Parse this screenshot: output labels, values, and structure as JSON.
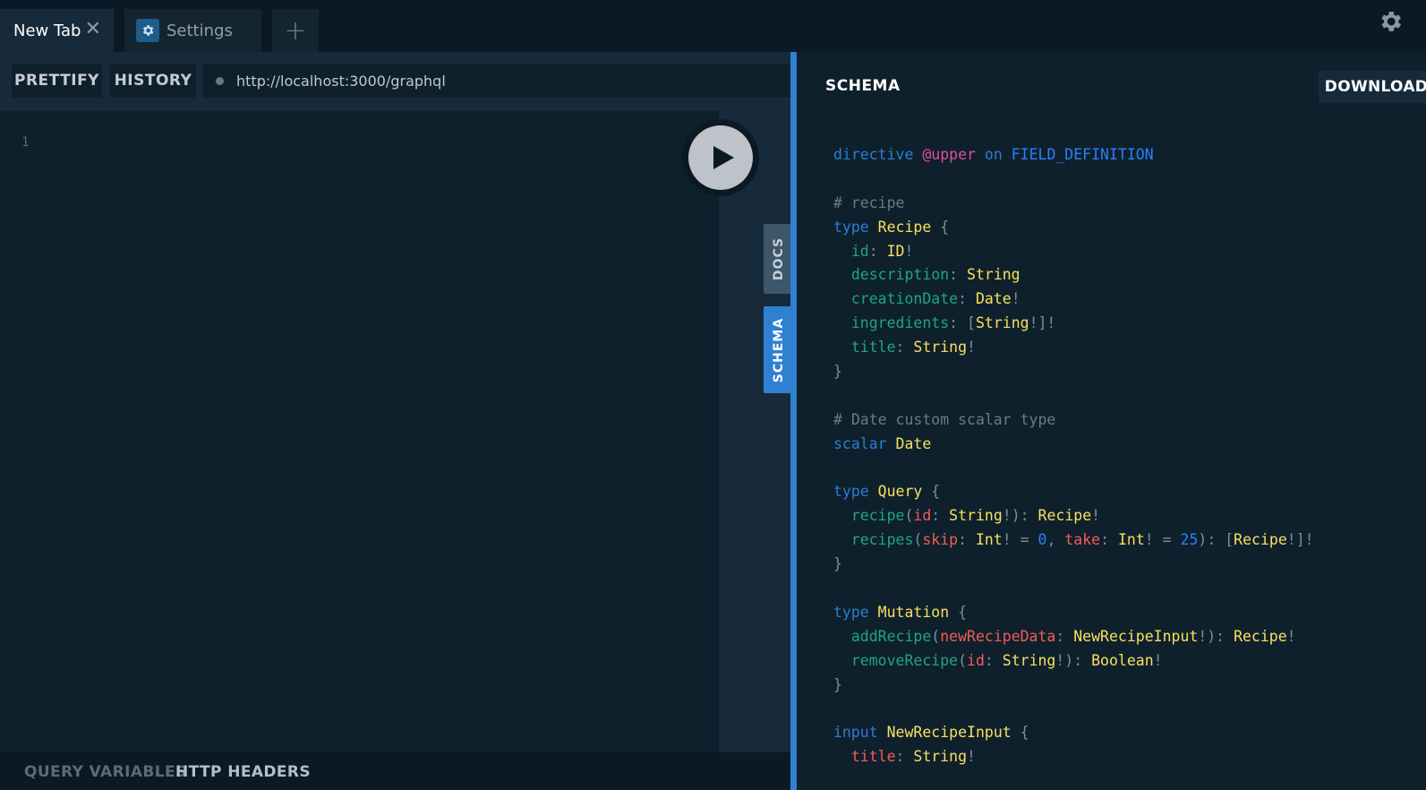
{
  "tabs": {
    "new_tab_label": "New Tab",
    "settings_label": "Settings",
    "add_label": "+"
  },
  "toolbar": {
    "prettify_label": "PRETTIFY",
    "history_label": "HISTORY",
    "endpoint_url": "http://localhost:3000/graphql"
  },
  "editor": {
    "line_number": "1"
  },
  "side_tabs": {
    "docs_label": "DOCS",
    "schema_label": "SCHEMA"
  },
  "bottom_bar": {
    "query_variables_label": "QUERY VARIABLES",
    "http_headers_label": "HTTP HEADERS"
  },
  "schema_panel": {
    "title": "SCHEMA",
    "download_label": "DOWNLOAD",
    "code": [
      [
        [
          "k",
          "directive "
        ],
        [
          "d",
          "@upper"
        ],
        [
          "k",
          " on "
        ],
        [
          "n",
          "FIELD_DEFINITION"
        ]
      ],
      [],
      [
        [
          "c",
          "# recipe"
        ]
      ],
      [
        [
          "k",
          "type "
        ],
        [
          "t",
          "Recipe"
        ],
        [
          "p",
          " {"
        ]
      ],
      [
        [
          "f",
          "  id"
        ],
        [
          "p",
          ": "
        ],
        [
          "t",
          "ID"
        ],
        [
          "p",
          "!"
        ]
      ],
      [
        [
          "f",
          "  description"
        ],
        [
          "p",
          ": "
        ],
        [
          "t",
          "String"
        ]
      ],
      [
        [
          "f",
          "  creationDate"
        ],
        [
          "p",
          ": "
        ],
        [
          "t",
          "Date"
        ],
        [
          "p",
          "!"
        ]
      ],
      [
        [
          "f",
          "  ingredients"
        ],
        [
          "p",
          ": ["
        ],
        [
          "t",
          "String"
        ],
        [
          "p",
          "!]!"
        ]
      ],
      [
        [
          "f",
          "  title"
        ],
        [
          "p",
          ": "
        ],
        [
          "t",
          "String"
        ],
        [
          "p",
          "!"
        ]
      ],
      [
        [
          "p",
          "}"
        ]
      ],
      [],
      [
        [
          "c",
          "# Date custom scalar type"
        ]
      ],
      [
        [
          "k",
          "scalar "
        ],
        [
          "t",
          "Date"
        ]
      ],
      [],
      [
        [
          "k",
          "type "
        ],
        [
          "t",
          "Query"
        ],
        [
          "p",
          " {"
        ]
      ],
      [
        [
          "f",
          "  recipe"
        ],
        [
          "p",
          "("
        ],
        [
          "a",
          "id"
        ],
        [
          "p",
          ": "
        ],
        [
          "t",
          "String"
        ],
        [
          "p",
          "!): "
        ],
        [
          "t",
          "Recipe"
        ],
        [
          "p",
          "!"
        ]
      ],
      [
        [
          "f",
          "  recipes"
        ],
        [
          "p",
          "("
        ],
        [
          "a",
          "skip"
        ],
        [
          "p",
          ": "
        ],
        [
          "t",
          "Int"
        ],
        [
          "p",
          "! = "
        ],
        [
          "n",
          "0"
        ],
        [
          "p",
          ", "
        ],
        [
          "a",
          "take"
        ],
        [
          "p",
          ": "
        ],
        [
          "t",
          "Int"
        ],
        [
          "p",
          "! = "
        ],
        [
          "n",
          "25"
        ],
        [
          "p",
          "): ["
        ],
        [
          "t",
          "Recipe"
        ],
        [
          "p",
          "!]!"
        ]
      ],
      [
        [
          "p",
          "}"
        ]
      ],
      [],
      [
        [
          "k",
          "type "
        ],
        [
          "t",
          "Mutation"
        ],
        [
          "p",
          " {"
        ]
      ],
      [
        [
          "f",
          "  addRecipe"
        ],
        [
          "p",
          "("
        ],
        [
          "a",
          "newRecipeData"
        ],
        [
          "p",
          ": "
        ],
        [
          "t",
          "NewRecipeInput"
        ],
        [
          "p",
          "!): "
        ],
        [
          "t",
          "Recipe"
        ],
        [
          "p",
          "!"
        ]
      ],
      [
        [
          "f",
          "  removeRecipe"
        ],
        [
          "p",
          "("
        ],
        [
          "a",
          "id"
        ],
        [
          "p",
          ": "
        ],
        [
          "t",
          "String"
        ],
        [
          "p",
          "!): "
        ],
        [
          "t",
          "Boolean"
        ],
        [
          "p",
          "!"
        ]
      ],
      [
        [
          "p",
          "}"
        ]
      ],
      [],
      [
        [
          "k",
          "input "
        ],
        [
          "t",
          "NewRecipeInput"
        ],
        [
          "p",
          " {"
        ]
      ],
      [
        [
          "a",
          "  title"
        ],
        [
          "p",
          ": "
        ],
        [
          "t",
          "String"
        ],
        [
          "p",
          "!"
        ]
      ]
    ]
  },
  "colors": {
    "accent": "#2f80d1",
    "keyword": "#2a7ed2",
    "type_name": "#f8e05a",
    "field": "#1fa67a",
    "argument": "#f25c54",
    "directive": "#e04ea0",
    "comment": "#6c7a85"
  },
  "icons": {
    "close": "close-icon",
    "settings": "gear-icon",
    "add": "plus-icon",
    "run": "play-icon"
  }
}
